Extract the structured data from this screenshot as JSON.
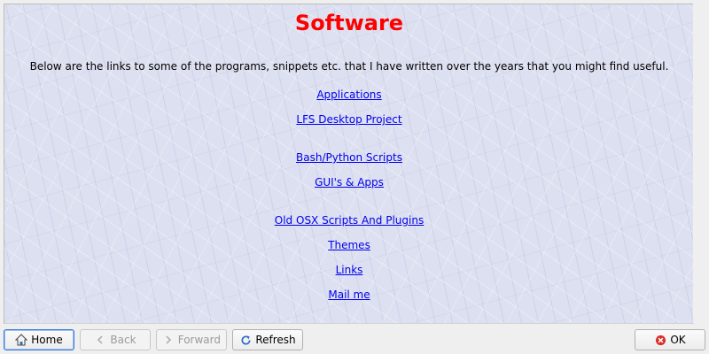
{
  "page": {
    "title": "Software",
    "intro": "Below are the links to some of the programs, snippets etc. that I have written over the years that you might find useful."
  },
  "links": [
    {
      "label": "Applications"
    },
    {
      "label": "LFS Desktop Project"
    },
    {
      "label": "Bash/Python Scripts"
    },
    {
      "label": "GUI's & Apps"
    },
    {
      "label": "Old OSX Scripts And Plugins"
    },
    {
      "label": "Themes"
    },
    {
      "label": "Links"
    },
    {
      "label": "Mail me"
    }
  ],
  "toolbar": {
    "home_label": "Home",
    "back_label": "Back",
    "forward_label": "Forward",
    "refresh_label": "Refresh",
    "ok_label": "OK"
  },
  "colors": {
    "title": "#ff0000",
    "link": "#0000ee",
    "background": "#dde0f0"
  },
  "icons": {
    "home": "home-icon",
    "back": "arrow-left-icon",
    "forward": "arrow-right-icon",
    "refresh": "refresh-icon",
    "ok": "close-circle-icon"
  }
}
